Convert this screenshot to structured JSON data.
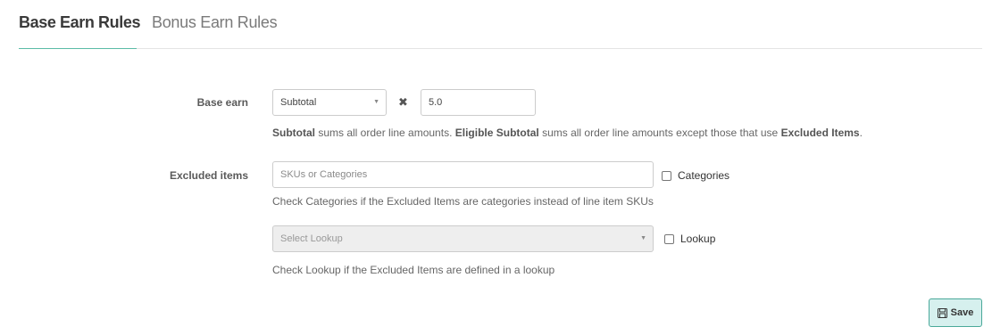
{
  "tabs": [
    {
      "label": "Base Earn Rules",
      "active": true
    },
    {
      "label": "Bonus Earn Rules",
      "active": false
    }
  ],
  "base_earn": {
    "label": "Base earn",
    "select_value": "Subtotal",
    "multiplier_value": "5.0",
    "help_parts": {
      "p1": "Subtotal",
      "p2": " sums all order line amounts. ",
      "p3": "Eligible Subtotal",
      "p4": " sums all order line amounts except those that use ",
      "p5": "Excluded Items",
      "p6": "."
    }
  },
  "excluded_items": {
    "label": "Excluded items",
    "input_placeholder": "SKUs or Categories",
    "categories_label": "Categories",
    "categories_help": "Check Categories if the Excluded Items are categories instead of line item SKUs",
    "lookup_select_placeholder": "Select Lookup",
    "lookup_label": "Lookup",
    "lookup_help": "Check Lookup if the Excluded Items are defined in a lookup"
  },
  "save_label": "Save",
  "colors": {
    "accent": "#5bbca6",
    "save_bg": "#d6f0ee",
    "save_border": "#4aa99a"
  }
}
